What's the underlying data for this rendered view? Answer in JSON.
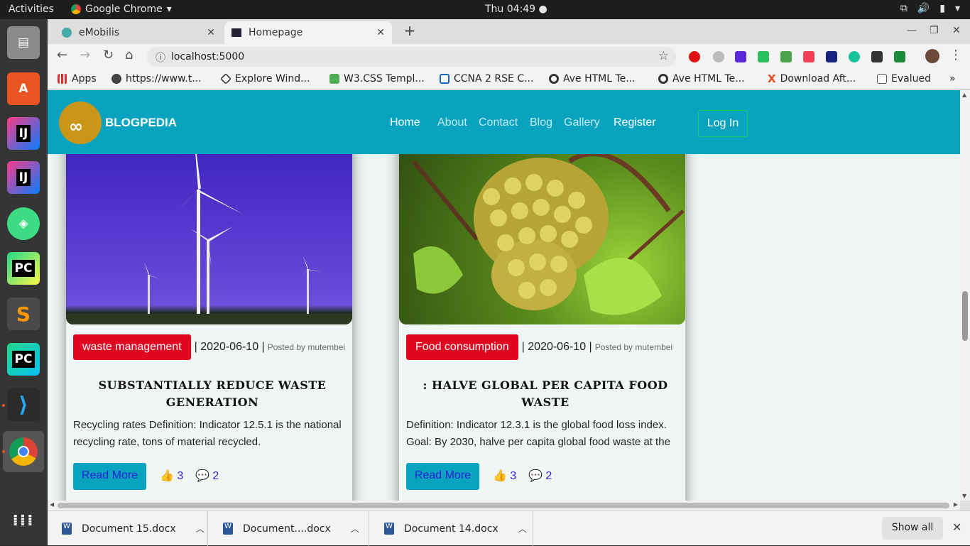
{
  "system": {
    "activities": "Activities",
    "app_name": "Google Chrome",
    "clock": "Thu 04:49"
  },
  "browser": {
    "tabs": [
      {
        "title": "eMobilis"
      },
      {
        "title": "Homepage"
      }
    ],
    "url": "localhost:5000",
    "bookmarks": [
      {
        "label": "Apps"
      },
      {
        "label": "https://www.t..."
      },
      {
        "label": "Explore Wind..."
      },
      {
        "label": "W3.CSS Templ..."
      },
      {
        "label": "CCNA 2 RSE C..."
      },
      {
        "label": "Ave HTML Te..."
      },
      {
        "label": "Ave HTML Te..."
      },
      {
        "label": "Download Aft..."
      },
      {
        "label": "Evalued"
      }
    ]
  },
  "site": {
    "brand": "BLOGPEDIA",
    "nav": {
      "home": "Home",
      "about": "About",
      "contact": "Contact",
      "blog": "Blog",
      "gallery": "Gallery",
      "register": "Register",
      "login": "Log In"
    },
    "posts": [
      {
        "category": "waste management",
        "date": "| 2020-06-10 |",
        "posted_by": "Posted by mutembei",
        "title": "SUBSTANTIALLY REDUCE WASTE GENERATION",
        "excerpt": "Recycling rates Definition: Indicator 12.5.1 is the national recycling rate, tons of material recycled.",
        "read_more": "Read More",
        "likes": "3",
        "comments": "2"
      },
      {
        "category": "Food consumption",
        "date": "| 2020-06-10 |",
        "posted_by": "Posted by mutembei",
        "title": ": HALVE GLOBAL PER CAPITA FOOD WASTE",
        "excerpt": "Definition: Indicator 12.3.1 is the global food loss index. Goal: By 2030, halve per capita global food waste at the retail and consumer levels.",
        "read_more": "Read More",
        "likes": "3",
        "comments": "2"
      }
    ]
  },
  "downloads": {
    "items": [
      {
        "name": "Document 15.docx"
      },
      {
        "name": "Document....docx"
      },
      {
        "name": "Document 14.docx"
      }
    ],
    "show_all": "Show all"
  },
  "colors": {
    "navbar": "#0aa3bf",
    "category_badge": "#e0061f",
    "login_border": "#1ec76a"
  }
}
